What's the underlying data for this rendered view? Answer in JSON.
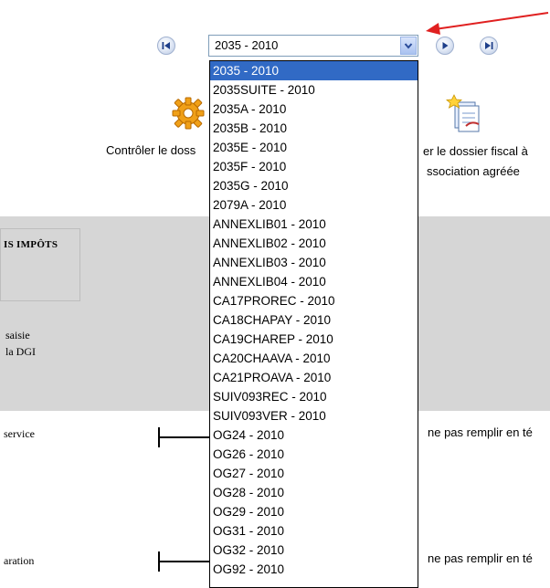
{
  "toolbar": {
    "select_value": "2035 - 2010",
    "first_icon": "first-page-icon",
    "prev_icon": "prev-page-icon",
    "next_icon": "next-page-icon",
    "last_icon": "last-page-icon"
  },
  "dropdown": {
    "options": [
      "2035 - 2010",
      "2035SUITE - 2010",
      "2035A - 2010",
      "2035B - 2010",
      "2035E - 2010",
      "2035F - 2010",
      "2035G - 2010",
      "2079A - 2010",
      "ANNEXLIB01 - 2010",
      "ANNEXLIB02 - 2010",
      "ANNEXLIB03 - 2010",
      "ANNEXLIB04 - 2010",
      "CA17PROREC - 2010",
      "CA18CHAPAY - 2010",
      "CA19CHAREP - 2010",
      "CA20CHAAVA - 2010",
      "CA21PROAVA - 2010",
      "SUIV093REC - 2010",
      "SUIV093VER - 2010",
      "OG24 - 2010",
      "OG26 - 2010",
      "OG27 - 2010",
      "OG28 - 2010",
      "OG29 - 2010",
      "OG31 - 2010",
      "OG32 - 2010",
      "OG92 - 2010"
    ],
    "selected_index": 0
  },
  "actions": {
    "control_label": "Contrôler le doss",
    "control_icon": "gear-icon",
    "send_label_line1": "er le dossier fiscal à",
    "send_label_line2": "ssociation agréée",
    "send_icon": "send-document-icon"
  },
  "gray_section": {
    "impots_text": "IS IMPÔTS",
    "saisie_line1": "saisie",
    "saisie_line2": "la DGI"
  },
  "rows": [
    {
      "left_text": "service",
      "right_text": "ne pas remplir en té"
    },
    {
      "left_text": "aration",
      "right_text": "ne pas remplir en té"
    }
  ],
  "annotation": {
    "arrow_color": "#e02020"
  }
}
